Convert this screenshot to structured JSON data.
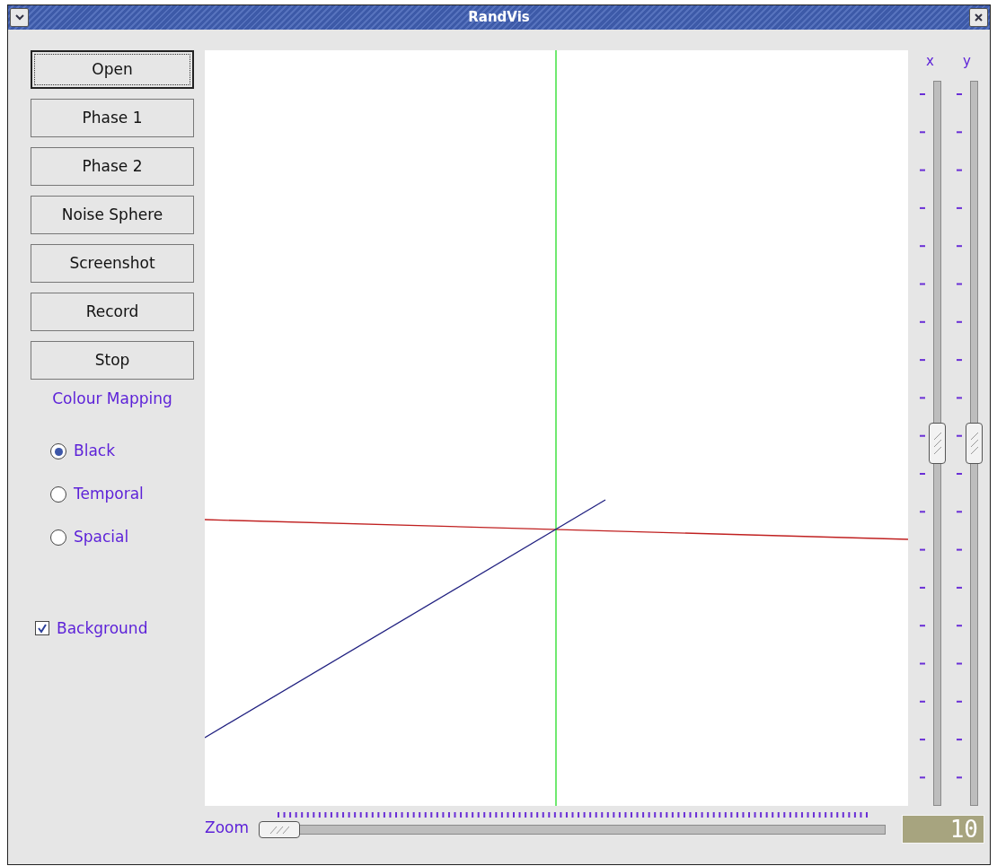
{
  "window": {
    "title": "RandVis"
  },
  "buttons": [
    {
      "label": "Open",
      "focused": true
    },
    {
      "label": "Phase 1",
      "focused": false
    },
    {
      "label": "Phase 2",
      "focused": false
    },
    {
      "label": "Noise Sphere",
      "focused": false
    },
    {
      "label": "Screenshot",
      "focused": false
    },
    {
      "label": "Record",
      "focused": false
    },
    {
      "label": "Stop",
      "focused": false
    }
  ],
  "colour_mapping": {
    "title": "Colour Mapping",
    "options": [
      {
        "label": "Black",
        "selected": true
      },
      {
        "label": "Temporal",
        "selected": false
      },
      {
        "label": "Spacial",
        "selected": false
      }
    ]
  },
  "background": {
    "label": "Background",
    "checked": true
  },
  "sliders": [
    {
      "label": "x",
      "level": 0.5
    },
    {
      "label": "y",
      "level": 0.5
    }
  ],
  "zoom": {
    "label": "Zoom",
    "level": 0,
    "display": "10"
  }
}
